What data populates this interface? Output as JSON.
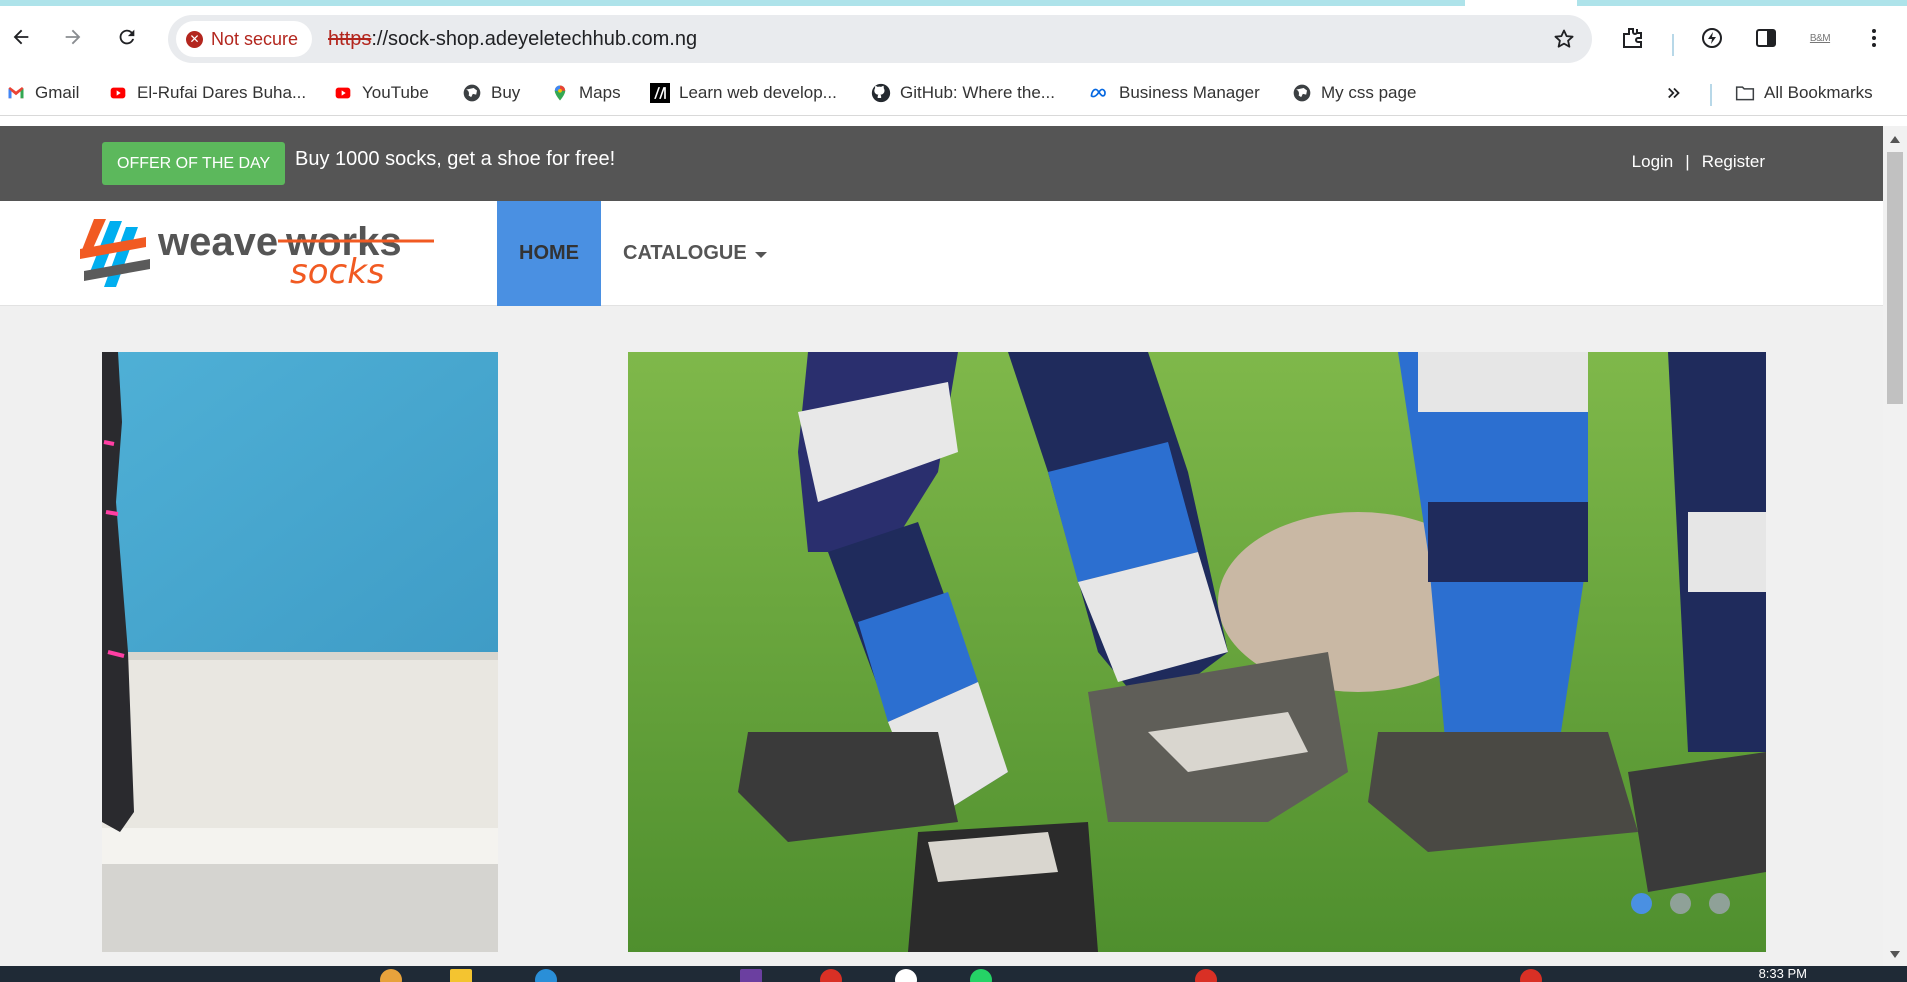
{
  "browser": {
    "security_chip": "Not secure",
    "url_protocol": "https",
    "url_rest": "://sock-shop.adeyeletechhub.com.ng",
    "profile_label": "B&M"
  },
  "bookmarks": [
    {
      "label": "Gmail",
      "icon": "gmail-icon"
    },
    {
      "label": "El-Rufai Dares Buha...",
      "icon": "youtube-icon"
    },
    {
      "label": "YouTube",
      "icon": "youtube-icon"
    },
    {
      "label": "Buy",
      "icon": "globe-icon"
    },
    {
      "label": "Maps",
      "icon": "maps-pin-icon"
    },
    {
      "label": "Learn web develop...",
      "icon": "mdn-icon"
    },
    {
      "label": "GitHub: Where the...",
      "icon": "github-icon"
    },
    {
      "label": "Business Manager",
      "icon": "meta-icon"
    },
    {
      "label": "My css page",
      "icon": "globe-icon"
    }
  ],
  "all_bookmarks": "All Bookmarks",
  "offer": {
    "badge": "OFFER OF THE DAY",
    "text": "Buy 1000 socks, get a shoe for free!"
  },
  "auth": {
    "login": "Login",
    "separator": "|",
    "register": "Register"
  },
  "logo": {
    "part1": "weave",
    "part2": "works",
    "part3": "socks"
  },
  "nav": {
    "home": "HOME",
    "catalogue": "CATALOGUE"
  },
  "carousel": {
    "slides": 3,
    "active": 1
  },
  "taskbar": {
    "clock": "8:33 PM"
  },
  "colors": {
    "offer_bar": "#555555",
    "offer_badge": "#5cb85c",
    "nav_active": "#4a90e2",
    "page_bg": "#f0f0f0",
    "logo_orange": "#f15a22",
    "logo_blue": "#00aeef"
  }
}
